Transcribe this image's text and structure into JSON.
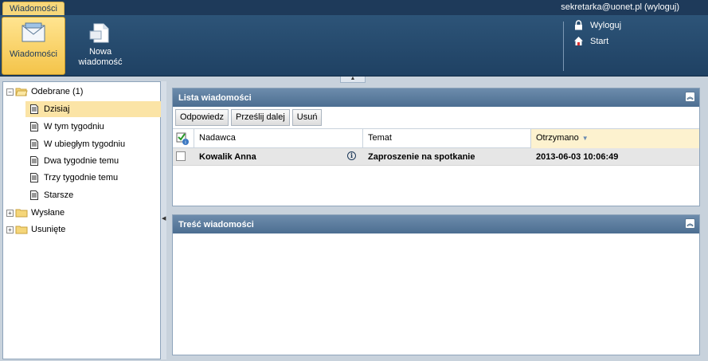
{
  "app": {
    "tab": "Wiadomości",
    "user_status": "sekretarka@uonet.pl (wyloguj)"
  },
  "ribbon": {
    "messages_label": "Wiadomości",
    "new_message_line1": "Nowa",
    "new_message_line2": "wiadomość",
    "logout_label": "Wyloguj",
    "start_label": "Start"
  },
  "tree": {
    "inbox": "Odebrane (1)",
    "today": "Dzisiaj",
    "this_week": "W tym tygodniu",
    "last_week": "W ubiegłym tygodniu",
    "two_weeks": "Dwa tygodnie temu",
    "three_weeks": "Trzy tygodnie temu",
    "older": "Starsze",
    "sent": "Wysłane",
    "deleted": "Usunięte"
  },
  "list_panel": {
    "title": "Lista wiadomości",
    "reply": "Odpowiedz",
    "forward": "Prześlij dalej",
    "delete": "Usuń",
    "columns": {
      "sender": "Nadawca",
      "subject": "Temat",
      "received": "Otrzymano"
    },
    "rows": [
      {
        "sender": "Kowalik Anna",
        "subject": "Zaproszenie na spotkanie",
        "received": "2013-06-03 10:06:49"
      }
    ]
  },
  "content_panel": {
    "title": "Treść wiadomości"
  },
  "colors": {
    "header_dark": "#1e3a5a",
    "accent_yellow": "#f4c44a",
    "panel_header": "#4c6e91"
  }
}
